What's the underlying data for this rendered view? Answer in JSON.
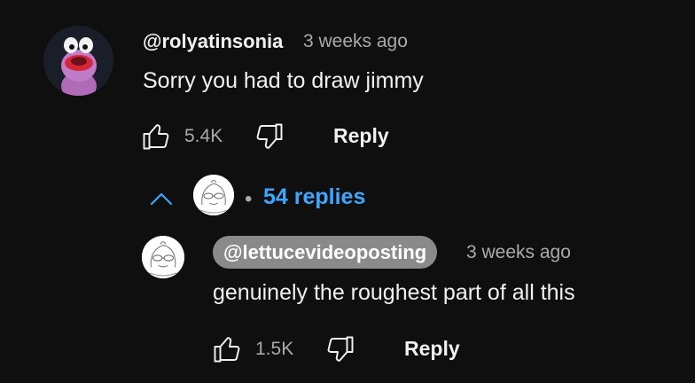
{
  "comment": {
    "author": "@rolyatinsonia",
    "time": "3 weeks ago",
    "text": "Sorry you had to draw jimmy",
    "likes": "5.4K",
    "reply_label": "Reply",
    "avatar_icon": "purple-creature-avatar"
  },
  "replies_toggle": {
    "separator": "•",
    "count_label": "54 replies",
    "chevron_icon": "chevron-up-icon",
    "accent_color": "#3ea6ff"
  },
  "reply": {
    "author": "@lettucevideoposting",
    "time": "3 weeks ago",
    "text": "genuinely the roughest part of all this",
    "likes": "1.5K",
    "reply_label": "Reply",
    "avatar_icon": "sketch-face-avatar",
    "badge_color": "#8a8a8a"
  },
  "icons": {
    "like": "thumbs-up-icon",
    "dislike": "thumbs-down-icon"
  }
}
